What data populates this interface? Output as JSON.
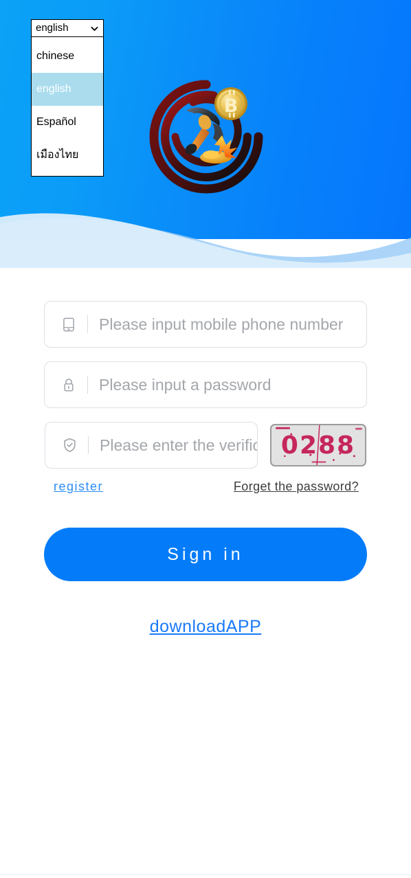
{
  "theme": {
    "hero_gradient_start": "#0ba2f7",
    "hero_gradient_end": "#0676fc",
    "primary_button": "#047cf9",
    "link_blue": "#2b8cf7",
    "download_link_blue": "#1a7af8",
    "captcha_text_color": "#c5275c",
    "captcha_bg": "#e2e2e2",
    "dropdown_highlight": "#aadcee",
    "input_border": "#dcdfe6",
    "placeholder_color": "#a4a7ac",
    "wave_light": "#dceefb",
    "wave_mid": "#9ccdf7"
  },
  "language_select": {
    "name": "language-select",
    "selected": "english",
    "expanded": true,
    "chevron_icon": "chevron-down-icon",
    "options": [
      {
        "label": "chinese",
        "selected": false
      },
      {
        "label": "english",
        "selected": true
      },
      {
        "label": "Español",
        "selected": false
      },
      {
        "label": "เมืองไทย",
        "selected": false
      }
    ]
  },
  "logo": {
    "name": "crypto-mining-logo",
    "icons": [
      "bitcoin-coin-icon",
      "pickaxe-icon",
      "gold-nugget-icon",
      "concentric-arc-ring"
    ],
    "bitcoin_symbol": "Ƀ",
    "arc_color_outer": "#8c1414",
    "arc_color_inner": "#1a1212"
  },
  "form": {
    "phone_field": {
      "name": "phone-input",
      "icon": "mobile-phone-icon",
      "placeholder": "Please input mobile phone number",
      "value": ""
    },
    "password_field": {
      "name": "password-input",
      "icon": "lock-icon",
      "placeholder": "Please input a password",
      "value": ""
    },
    "verification_field": {
      "name": "verification-code-input",
      "icon": "shield-check-icon",
      "placeholder": "Please enter the verification code",
      "value": ""
    },
    "captcha": {
      "name": "captcha-image",
      "code": "0288",
      "alt": "captcha-code-image"
    },
    "register_link": "register",
    "forget_password_link": "Forget the password?",
    "signin_button": "Sign in",
    "download_app_link": "downloadAPP"
  }
}
